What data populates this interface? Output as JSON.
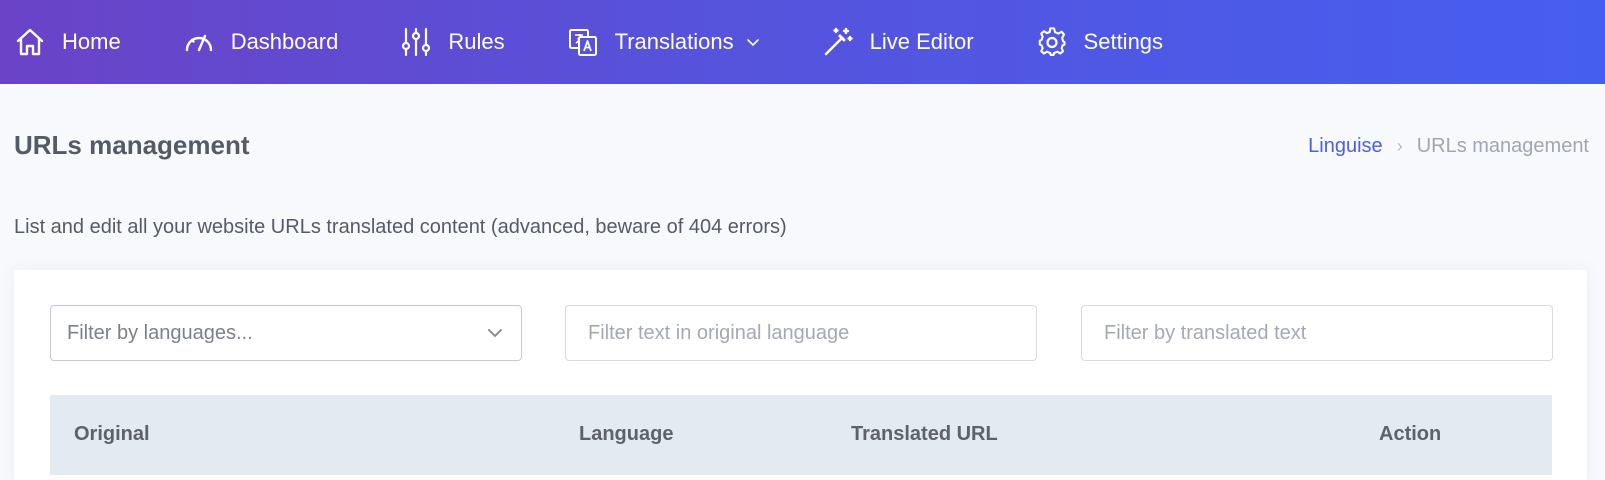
{
  "nav": {
    "items": [
      {
        "label": "Home",
        "icon": "home-icon"
      },
      {
        "label": "Dashboard",
        "icon": "gauge-icon"
      },
      {
        "label": "Rules",
        "icon": "sliders-icon"
      },
      {
        "label": "Translations",
        "icon": "translate-icon",
        "has_dropdown": true
      },
      {
        "label": "Live Editor",
        "icon": "magic-wand-icon"
      },
      {
        "label": "Settings",
        "icon": "gear-icon"
      }
    ],
    "gradient": [
      "#6a43c7",
      "#465ef0"
    ]
  },
  "page": {
    "title": "URLs management",
    "description": "List and edit all your website URLs translated content (advanced, beware of 404 errors)"
  },
  "breadcrumb": {
    "root": "Linguise",
    "current": "URLs management"
  },
  "filters": {
    "language_select": "Filter by languages...",
    "original_placeholder": "Filter text in original language",
    "translated_placeholder": "Filter by translated text"
  },
  "table": {
    "columns": [
      "Original",
      "Language",
      "Translated URL",
      "Action"
    ]
  },
  "colors": {
    "accent": "#4a5ee8",
    "table_header_bg": "#e2eaf2",
    "page_bg": "#f8f9fc"
  }
}
